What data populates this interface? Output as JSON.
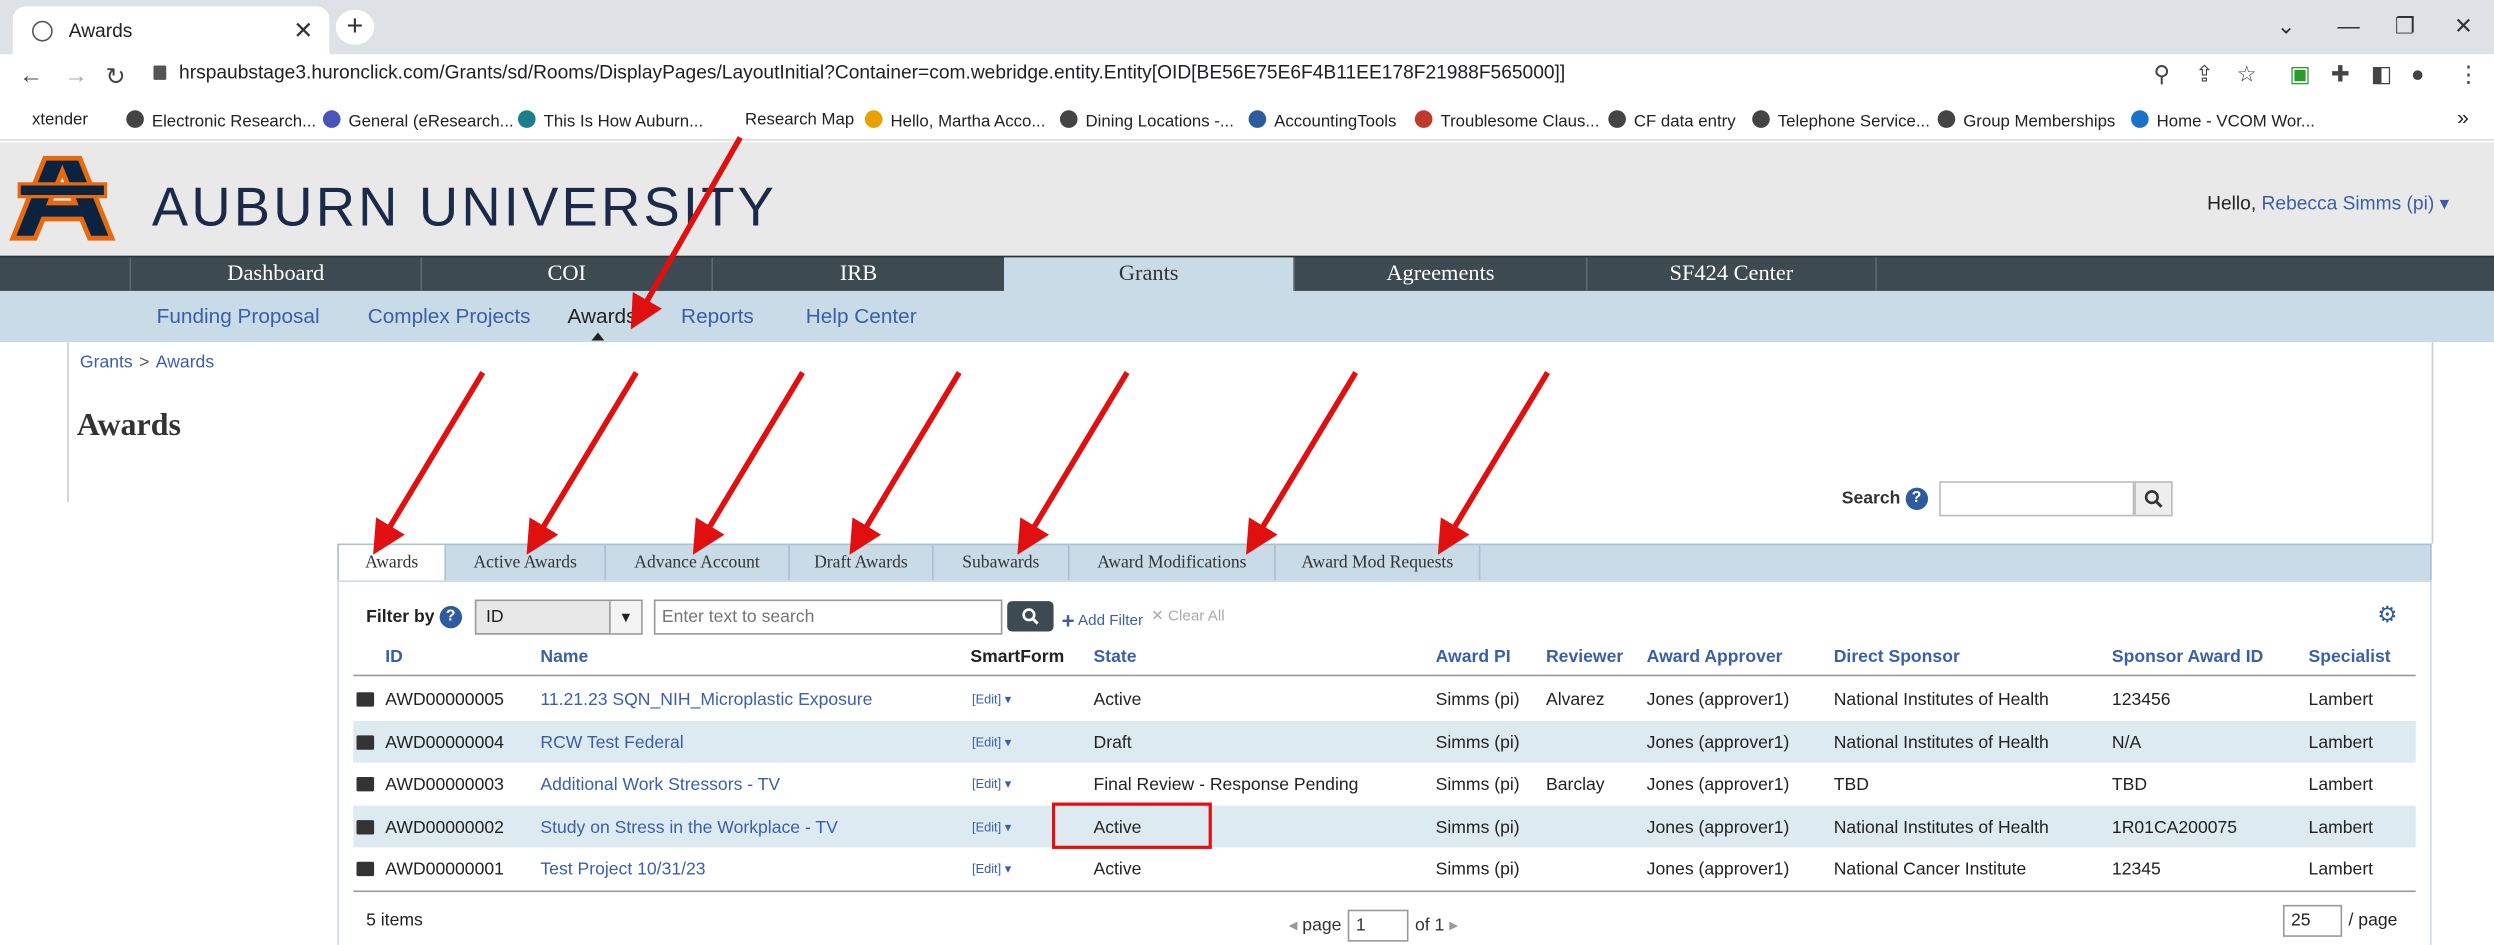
{
  "browser": {
    "tab_title": "Awards",
    "url": "hrspaubstage3.huronclick.com/Grants/sd/Rooms/DisplayPages/LayoutInitial?Container=com.webridge.entity.Entity[OID[BE56E75E6F4B11EE178F21988F565000]]",
    "bookmarks": [
      "xtender",
      "Electronic Research...",
      "General (eResearch...",
      "This Is How Auburn...",
      "Research Map",
      "Hello, Martha Acco...",
      "Dining Locations -...",
      "AccountingTools",
      "Troublesome Claus...",
      "CF data entry",
      "Telephone Service...",
      "Group Memberships",
      "Home - VCOM Wor..."
    ]
  },
  "site": {
    "university_name": "AUBURN UNIVERSITY",
    "greeting": "Hello,",
    "user_name": "Rebecca Simms (pi)",
    "main_nav": [
      "Dashboard",
      "COI",
      "IRB",
      "Grants",
      "Agreements",
      "SF424 Center"
    ],
    "active_main_nav": "Grants",
    "sub_nav": [
      "Funding Proposal",
      "Complex Projects",
      "Awards",
      "Reports",
      "Help Center"
    ],
    "active_sub_nav": "Awards",
    "breadcrumb": [
      "Grants",
      "Awards"
    ],
    "breadcrumb_sep": ">",
    "page_title": "Awards",
    "search_label": "Search",
    "search_value": ""
  },
  "tabs": [
    "Awards",
    "Active Awards",
    "Advance Account",
    "Draft Awards",
    "Subawards",
    "Award Modifications",
    "Award Mod Requests"
  ],
  "active_tab": "Awards",
  "filter": {
    "label": "Filter by",
    "field": "ID",
    "placeholder": "Enter text to search",
    "add_filter": "Add Filter",
    "clear_all": "Clear All"
  },
  "table": {
    "columns": [
      "ID",
      "Name",
      "SmartForm",
      "State",
      "Award PI",
      "Reviewer",
      "Award Approver",
      "Direct Sponsor",
      "Sponsor Award ID",
      "Specialist"
    ],
    "rows": [
      {
        "id": "AWD00000005",
        "name": "11.21.23 SQN_NIH_Microplastic Exposure",
        "smartform": "[Edit]",
        "state": "Active",
        "pi": "Simms (pi)",
        "reviewer": "Alvarez",
        "approver": "Jones (approver1)",
        "sponsor": "National Institutes of Health",
        "sponsor_award_id": "123456",
        "specialist": "Lambert"
      },
      {
        "id": "AWD00000004",
        "name": "RCW Test Federal",
        "smartform": "[Edit]",
        "state": "Draft",
        "pi": "Simms (pi)",
        "reviewer": "",
        "approver": "Jones (approver1)",
        "sponsor": "National Institutes of Health",
        "sponsor_award_id": "N/A",
        "specialist": "Lambert"
      },
      {
        "id": "AWD00000003",
        "name": "Additional Work Stressors - TV",
        "smartform": "[Edit]",
        "state": "Final Review - Response Pending",
        "pi": "Simms (pi)",
        "reviewer": "Barclay",
        "approver": "Jones (approver1)",
        "sponsor": "TBD",
        "sponsor_award_id": "TBD",
        "specialist": "Lambert"
      },
      {
        "id": "AWD00000002",
        "name": "Study on Stress in the Workplace - TV",
        "smartform": "[Edit]",
        "state": "Active",
        "pi": "Simms (pi)",
        "reviewer": "",
        "approver": "Jones (approver1)",
        "sponsor": "National Institutes of Health",
        "sponsor_award_id": "1R01CA200075",
        "specialist": "Lambert"
      },
      {
        "id": "AWD00000001",
        "name": "Test Project 10/31/23",
        "smartform": "[Edit]",
        "state": "Active",
        "pi": "Simms (pi)",
        "reviewer": "",
        "approver": "Jones (approver1)",
        "sponsor": "National Cancer Institute",
        "sponsor_award_id": "12345",
        "specialist": "Lambert"
      }
    ]
  },
  "footer": {
    "items_count": "5 items",
    "page_label": "page",
    "page_value": "1",
    "of_pages": "of 1",
    "per_page_value": "25",
    "per_page_label": "/ page"
  },
  "colors": {
    "annotation": "#e01010",
    "nav_bg": "#3e4a52",
    "subnav_bg": "#c8dbe6",
    "link": "#3a5fa8",
    "brand_orange": "#e86a10",
    "brand_navy": "#0c2340"
  }
}
